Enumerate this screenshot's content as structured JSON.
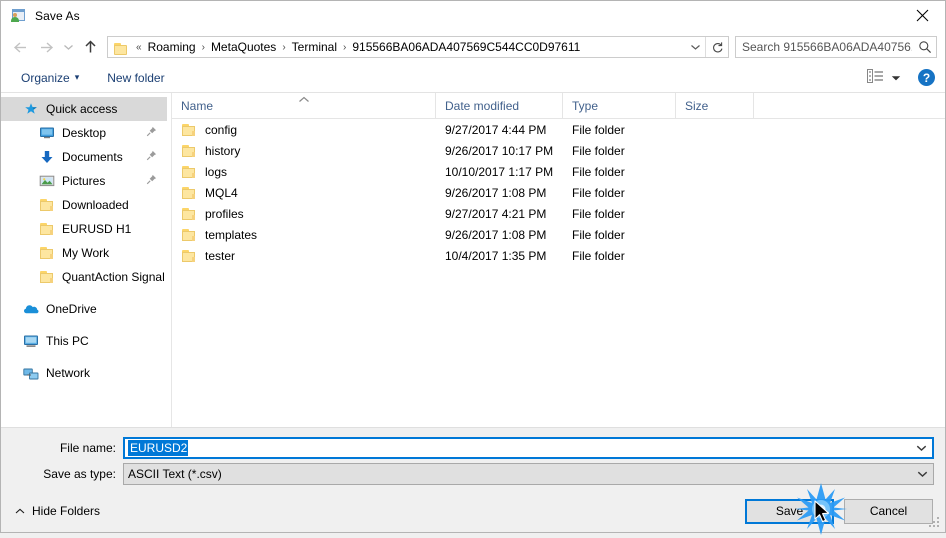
{
  "window": {
    "title": "Save As",
    "icon": "save-as-app-icon",
    "close_label": "✕"
  },
  "nav": {
    "back_icon": "arrow-left-icon",
    "forward_icon": "arrow-right-icon",
    "recent_icon": "chevron-down-icon",
    "up_icon": "arrow-up-icon",
    "breadcrumb": {
      "folder_icon": "folder-icon",
      "overflow": "«",
      "items": [
        "Roaming",
        "MetaQuotes",
        "Terminal",
        "915566BA06ADA407569C544CC0D97611"
      ],
      "separator": "›",
      "dropdown_icon": "chevron-down-icon",
      "refresh_icon": "refresh-icon"
    },
    "search": {
      "placeholder": "Search 915566BA06ADA40756...",
      "value": "",
      "icon": "search-icon"
    }
  },
  "commandbar": {
    "organize": "Organize",
    "organize_caret": "▾",
    "new_folder": "New folder",
    "view_icon": "view-layout-icon",
    "view_caret": "▾",
    "help_label": "?"
  },
  "sidebar": {
    "items": [
      {
        "label": "Quick access",
        "icon": "star-icon",
        "level": "group",
        "selected": true,
        "pinned": false
      },
      {
        "label": "Desktop",
        "icon": "desktop-icon",
        "level": "child",
        "selected": false,
        "pinned": true
      },
      {
        "label": "Documents",
        "icon": "download-arrow-icon",
        "level": "child",
        "selected": false,
        "pinned": true
      },
      {
        "label": "Pictures",
        "icon": "pictures-icon",
        "level": "child",
        "selected": false,
        "pinned": true
      },
      {
        "label": "Downloaded",
        "icon": "folder-icon",
        "level": "child",
        "selected": false,
        "pinned": false
      },
      {
        "label": "EURUSD H1",
        "icon": "folder-icon",
        "level": "child",
        "selected": false,
        "pinned": false
      },
      {
        "label": "My Work",
        "icon": "folder-icon",
        "level": "child",
        "selected": false,
        "pinned": false
      },
      {
        "label": "QuantAction Signal",
        "icon": "folder-icon",
        "level": "child",
        "selected": false,
        "pinned": false
      },
      {
        "label": "OneDrive",
        "icon": "onedrive-icon",
        "level": "group",
        "selected": false,
        "pinned": false,
        "gap_before": true
      },
      {
        "label": "This PC",
        "icon": "this-pc-icon",
        "level": "group",
        "selected": false,
        "pinned": false,
        "gap_before": true
      },
      {
        "label": "Network",
        "icon": "network-icon",
        "level": "group",
        "selected": false,
        "pinned": false,
        "gap_before": true
      }
    ]
  },
  "filelist": {
    "columns": [
      "Name",
      "Date modified",
      "Type",
      "Size"
    ],
    "sort_column": "Name",
    "sort_caret": "˄",
    "rows": [
      {
        "name": "config",
        "date": "9/27/2017 4:44 PM",
        "type": "File folder",
        "size": ""
      },
      {
        "name": "history",
        "date": "9/26/2017 10:17 PM",
        "type": "File folder",
        "size": ""
      },
      {
        "name": "logs",
        "date": "10/10/2017 1:17 PM",
        "type": "File folder",
        "size": ""
      },
      {
        "name": "MQL4",
        "date": "9/26/2017 1:08 PM",
        "type": "File folder",
        "size": ""
      },
      {
        "name": "profiles",
        "date": "9/27/2017 4:21 PM",
        "type": "File folder",
        "size": ""
      },
      {
        "name": "templates",
        "date": "9/26/2017 1:08 PM",
        "type": "File folder",
        "size": ""
      },
      {
        "name": "tester",
        "date": "10/4/2017 1:35 PM",
        "type": "File folder",
        "size": ""
      }
    ]
  },
  "form": {
    "filename_label": "File name:",
    "filename_value": "EURUSD2",
    "filetype_label": "Save as type:",
    "filetype_value": "ASCII Text (*.csv)",
    "dropdown_icon": "chevron-down-icon"
  },
  "footer": {
    "hide_folders": "Hide Folders",
    "hide_caret": "˄",
    "save": "Save",
    "cancel": "Cancel"
  },
  "colors": {
    "accent": "#0078d7",
    "breadcrumb_text": "#000000",
    "command_text": "#1b3f73",
    "column_header_text": "#42618c",
    "selection": "#d9d9d9",
    "help_blue": "#1673c4"
  }
}
